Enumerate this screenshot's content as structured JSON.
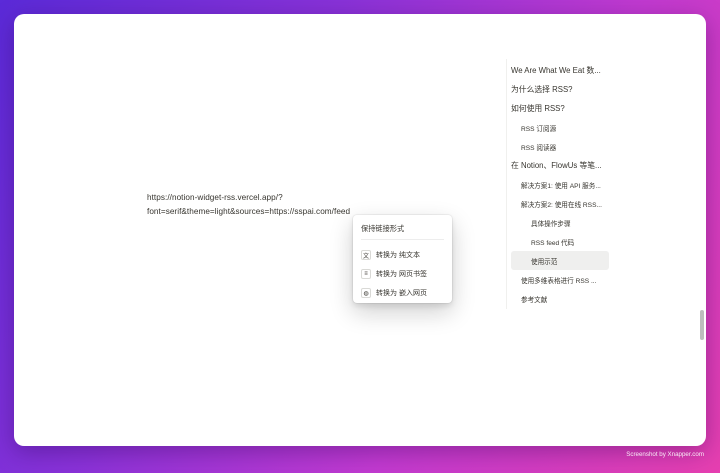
{
  "editor": {
    "url_line1": "https://notion-widget-rss.vercel.app/?",
    "url_line2": "font=serif&theme=light&sources=https://sspai.com/feed"
  },
  "context_menu": {
    "header": "保持链接形式",
    "items": [
      {
        "icon": "text-icon",
        "glyph": "文",
        "label": "转换为 纯文本"
      },
      {
        "icon": "bookmark-icon",
        "glyph": "≡",
        "label": "转换为 网页书签"
      },
      {
        "icon": "embed-icon",
        "glyph": "◍",
        "label": "转换为 嵌入网页"
      }
    ]
  },
  "toc": {
    "items": [
      {
        "label": "We Are What We Eat 数...",
        "level": 1
      },
      {
        "label": "为什么选择 RSS?",
        "level": 1
      },
      {
        "label": "如何使用 RSS?",
        "level": 1
      },
      {
        "label": "RSS 订阅源",
        "level": 2
      },
      {
        "label": "RSS 阅读器",
        "level": 2
      },
      {
        "label": "在 Notion、FlowUs 等笔...",
        "level": 1
      },
      {
        "label": "解决方案1: 使用 API 服务...",
        "level": 2
      },
      {
        "label": "解决方案2: 使用在线 RSS...",
        "level": 2
      },
      {
        "label": "具体操作步骤",
        "level": 3
      },
      {
        "label": "RSS feed 代码",
        "level": 3
      },
      {
        "label": "使用示范",
        "level": 3,
        "active": true
      },
      {
        "label": "使用多维表格进行 RSS ...",
        "level": 2
      },
      {
        "label": "参考文献",
        "level": 2
      }
    ]
  },
  "watermark": "Screenshot by Xnapper.com"
}
